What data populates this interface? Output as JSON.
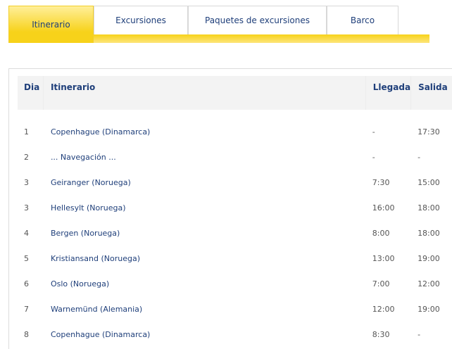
{
  "tabs": [
    {
      "label": "Itinerario",
      "active": true
    },
    {
      "label": "Excursiones",
      "active": false
    },
    {
      "label": "Paquetes de excursiones",
      "active": false
    },
    {
      "label": "Barco",
      "active": false
    }
  ],
  "colors": {
    "accent_yellow": "#f7d21a",
    "link_blue": "#1f3f7a",
    "header_bg": "#f3f3f3"
  },
  "table": {
    "headers": {
      "dia": "Dia",
      "itinerario": "Itinerario",
      "llegada": "Llegada",
      "salida": "Salida"
    },
    "rows": [
      {
        "dia": "1",
        "itinerario": "Copenhague (Dinamarca)",
        "llegada": "-",
        "salida": "17:30"
      },
      {
        "dia": "2",
        "itinerario": "... Navegación ...",
        "llegada": "-",
        "salida": "-"
      },
      {
        "dia": "3",
        "itinerario": "Geiranger (Noruega)",
        "llegada": "7:30",
        "salida": "15:00"
      },
      {
        "dia": "3",
        "itinerario": "Hellesylt (Noruega)",
        "llegada": "16:00",
        "salida": "18:00"
      },
      {
        "dia": "4",
        "itinerario": "Bergen (Noruega)",
        "llegada": "8:00",
        "salida": "18:00"
      },
      {
        "dia": "5",
        "itinerario": "Kristiansand (Noruega)",
        "llegada": "13:00",
        "salida": "19:00"
      },
      {
        "dia": "6",
        "itinerario": "Oslo (Noruega)",
        "llegada": "7:00",
        "salida": "12:00"
      },
      {
        "dia": "7",
        "itinerario": "Warnemünd (Alemania)",
        "llegada": "12:00",
        "salida": "19:00"
      },
      {
        "dia": "8",
        "itinerario": "Copenhague (Dinamarca)",
        "llegada": "8:30",
        "salida": "-"
      }
    ]
  }
}
